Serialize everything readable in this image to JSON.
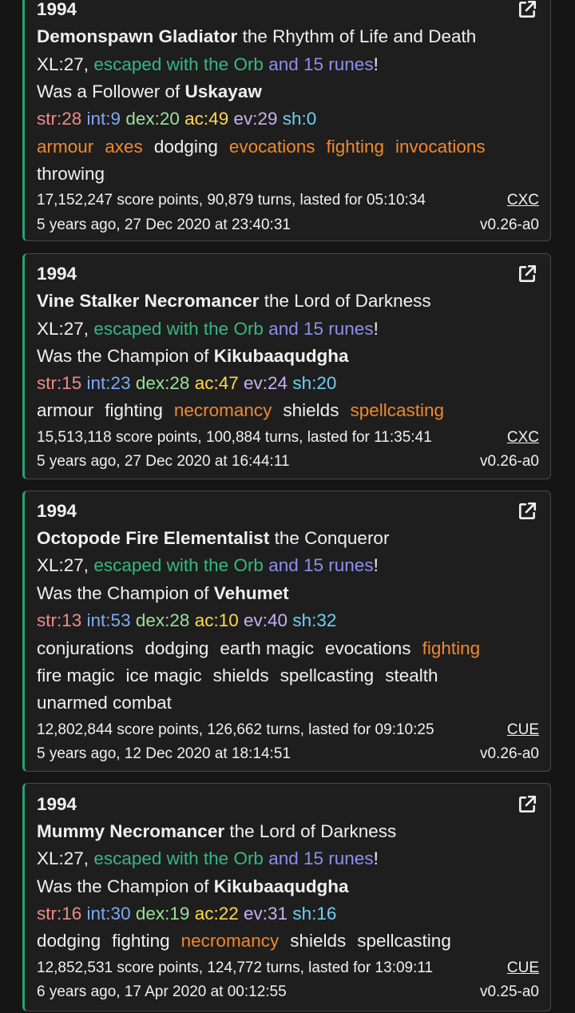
{
  "games": [
    {
      "year": "1994",
      "character": "Demonspawn Gladiator",
      "title": "the Rhythm of Life and Death",
      "xl": "XL:27,",
      "escaped": "escaped with the Orb",
      "runes": "and 15 runes",
      "bang": "!",
      "god_prefix": "Was a Follower of",
      "god": "Uskayaw",
      "stats": {
        "str": "str:28",
        "int": "int:9",
        "dex": "dex:20",
        "ac": "ac:49",
        "ev": "ev:29",
        "sh": "sh:0"
      },
      "skills": [
        {
          "name": "armour",
          "highlight": true
        },
        {
          "name": "axes",
          "highlight": true
        },
        {
          "name": "dodging",
          "highlight": false
        },
        {
          "name": "evocations",
          "highlight": true
        },
        {
          "name": "fighting",
          "highlight": true
        },
        {
          "name": "invocations",
          "highlight": true
        },
        {
          "name": "throwing",
          "highlight": false
        }
      ],
      "score_line": "17,152,247 score points, 90,879 turns, lasted for 05:10:34",
      "server": "CXC",
      "date_line": "5 years ago, 27 Dec 2020 at 23:40:31",
      "version": "v0.26-a0"
    },
    {
      "year": "1994",
      "character": "Vine Stalker Necromancer",
      "title": "the Lord of Darkness",
      "xl": "XL:27,",
      "escaped": "escaped with the Orb",
      "runes": "and 15 runes",
      "bang": "!",
      "god_prefix": "Was the Champion of",
      "god": "Kikubaaqudgha",
      "stats": {
        "str": "str:15",
        "int": "int:23",
        "dex": "dex:28",
        "ac": "ac:47",
        "ev": "ev:24",
        "sh": "sh:20"
      },
      "skills": [
        {
          "name": "armour",
          "highlight": false
        },
        {
          "name": "fighting",
          "highlight": false
        },
        {
          "name": "necromancy",
          "highlight": true
        },
        {
          "name": "shields",
          "highlight": false
        },
        {
          "name": "spellcasting",
          "highlight": true
        }
      ],
      "score_line": "15,513,118 score points, 100,884 turns, lasted for 11:35:41",
      "server": "CXC",
      "date_line": "5 years ago, 27 Dec 2020 at 16:44:11",
      "version": "v0.26-a0"
    },
    {
      "year": "1994",
      "character": "Octopode Fire Elementalist",
      "title": "the Conqueror",
      "xl": "XL:27,",
      "escaped": "escaped with the Orb",
      "runes": "and 15 runes",
      "bang": "!",
      "god_prefix": "Was the Champion of",
      "god": "Vehumet",
      "stats": {
        "str": "str:13",
        "int": "int:53",
        "dex": "dex:28",
        "ac": "ac:10",
        "ev": "ev:40",
        "sh": "sh:32"
      },
      "skills": [
        {
          "name": "conjurations",
          "highlight": false
        },
        {
          "name": "dodging",
          "highlight": false
        },
        {
          "name": "earth magic",
          "highlight": false
        },
        {
          "name": "evocations",
          "highlight": false
        },
        {
          "name": "fighting",
          "highlight": true
        },
        {
          "name": "fire magic",
          "highlight": false
        },
        {
          "name": "ice magic",
          "highlight": false
        },
        {
          "name": "shields",
          "highlight": false
        },
        {
          "name": "spellcasting",
          "highlight": false
        },
        {
          "name": "stealth",
          "highlight": false
        },
        {
          "name": "unarmed combat",
          "highlight": false
        }
      ],
      "score_line": "12,802,844 score points, 126,662 turns, lasted for 09:10:25",
      "server": "CUE",
      "date_line": "5 years ago, 12 Dec 2020 at 18:14:51",
      "version": "v0.26-a0"
    },
    {
      "year": "1994",
      "character": "Mummy Necromancer",
      "title": "the Lord of Darkness",
      "xl": "XL:27,",
      "escaped": "escaped with the Orb",
      "runes": "and 15 runes",
      "bang": "!",
      "god_prefix": "Was the Champion of",
      "god": "Kikubaaqudgha",
      "stats": {
        "str": "str:16",
        "int": "int:30",
        "dex": "dex:19",
        "ac": "ac:22",
        "ev": "ev:31",
        "sh": "sh:16"
      },
      "skills": [
        {
          "name": "dodging",
          "highlight": false
        },
        {
          "name": "fighting",
          "highlight": false
        },
        {
          "name": "necromancy",
          "highlight": true
        },
        {
          "name": "shields",
          "highlight": false
        },
        {
          "name": "spellcasting",
          "highlight": false
        }
      ],
      "score_line": "12,852,531 score points, 124,772 turns, lasted for 13:09:11",
      "server": "CUE",
      "date_line": "6 years ago, 17 Apr 2020 at 00:12:55",
      "version": "v0.25-a0"
    }
  ],
  "colors": {
    "accent": "#2aa46d",
    "escaped": "#36b784",
    "runes": "#8d90ee",
    "skill_highlight": "#f0882e",
    "str": "#ef8b86",
    "int": "#7fa8f5",
    "dex": "#9ae09a",
    "ac": "#ffd84f",
    "ev": "#c3b1f2",
    "sh": "#6fd0f2"
  },
  "icons": {
    "open": "external-link-icon"
  }
}
